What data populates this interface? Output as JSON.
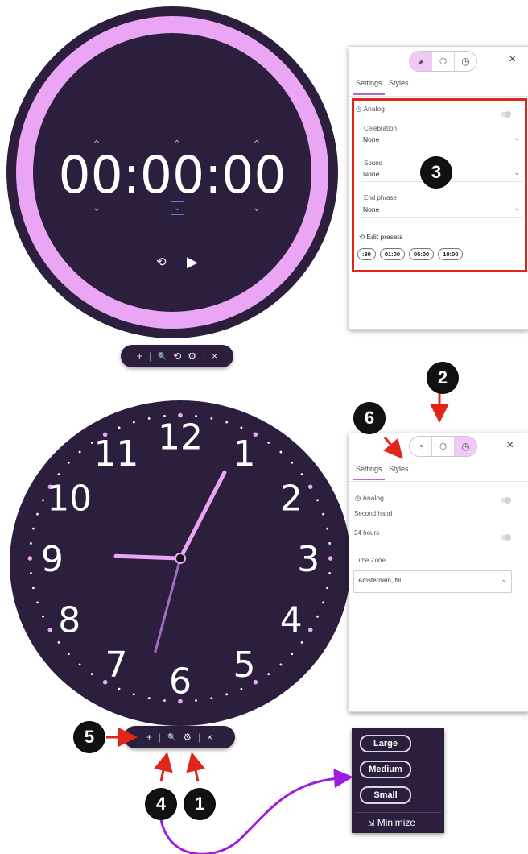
{
  "timer": {
    "display": "00:00:00",
    "toolbar": {
      "add": "+",
      "zoom": "🔍",
      "reset": "⟲",
      "settings": "⚙",
      "close": "×"
    }
  },
  "timer_settings": {
    "close": "×",
    "tabs": [
      "Settings",
      "Styles"
    ],
    "analog_label": "Analog",
    "celebration_label": "Celebration",
    "celebration_value": "None",
    "sound_label": "Sound",
    "sound_value": "None",
    "end_phrase_label": "End phrase",
    "end_phrase_value": "None",
    "edit_presets_label": "Edit presets",
    "presets": [
      ":30",
      "01:00",
      "05:00",
      "10:00"
    ]
  },
  "clock": {
    "numbers": [
      "12",
      "1",
      "2",
      "3",
      "4",
      "5",
      "6",
      "7",
      "8",
      "9",
      "10",
      "11"
    ],
    "time": {
      "hour": 9,
      "minute": 4,
      "second": 32.5
    }
  },
  "clock_settings": {
    "close": "×",
    "tabs": [
      "Settings",
      "Styles"
    ],
    "analog_label": "Analog",
    "second_hand_label": "Second hand",
    "hours24_label": "24 hours",
    "timezone_label": "Time Zone",
    "timezone_value": "Amsterdam, NL"
  },
  "clock_toolbar": {
    "add": "+",
    "zoom": "🔍",
    "settings": "⚙",
    "close": "×"
  },
  "size_menu": {
    "large": "Large",
    "medium": "Medium",
    "small": "Small",
    "minimize": "Minimize"
  },
  "annotations": [
    "1",
    "2",
    "3",
    "4",
    "5",
    "6"
  ],
  "colors": {
    "dark": "#2b1f3d",
    "accent": "#eaa6f4",
    "annotation_red": "#e1251b",
    "annotation_purple": "#9b1de0"
  }
}
